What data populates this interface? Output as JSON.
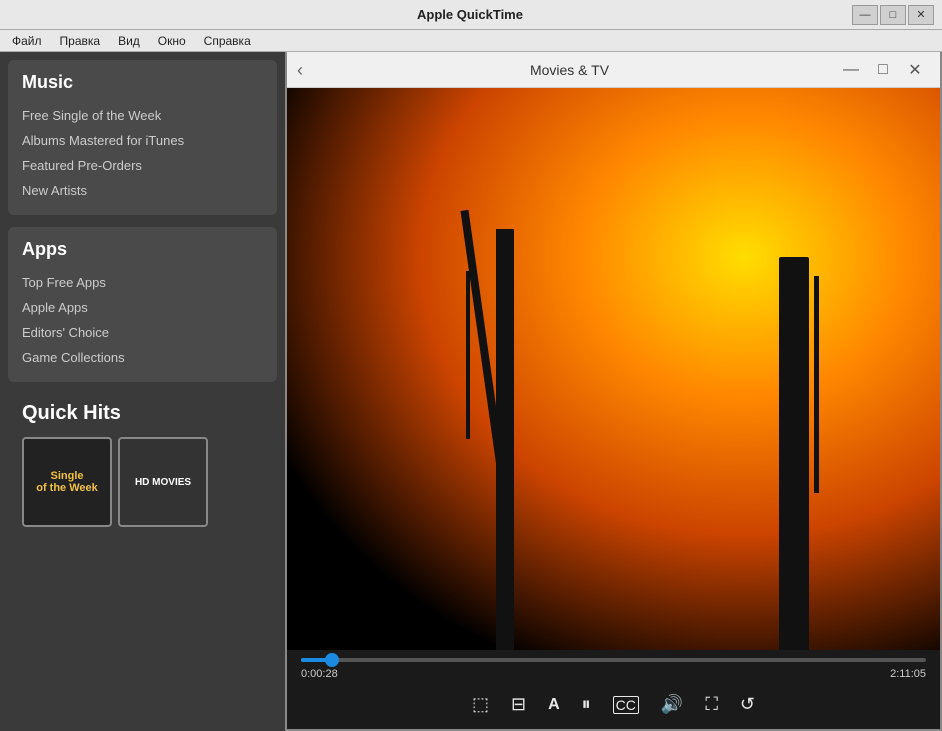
{
  "window": {
    "title": "Apple QuickTime",
    "controls": {
      "minimize": "—",
      "maximize": "□",
      "close": "✕"
    }
  },
  "menu": {
    "items": [
      "Файл",
      "Правка",
      "Вид",
      "Окно",
      "Справка"
    ]
  },
  "sidebar": {
    "music_section": {
      "title": "Music",
      "links": [
        "Free Single of the Week",
        "Albums Mastered for iTunes",
        "Featured Pre-Orders",
        "New Artists"
      ]
    },
    "apps_section": {
      "title": "Apps",
      "links": [
        "Top Free Apps",
        "Apple Apps",
        "Editors' Choice",
        "Game Collections"
      ]
    },
    "quick_hits": {
      "title": "Quick Hits",
      "thumbnail1_text": "Single\nof the Week",
      "thumbnail2_text": "HD MOVIES"
    }
  },
  "video_window": {
    "title": "Movies & TV",
    "back_btn": "‹",
    "minimize": "—",
    "maximize": "□",
    "close": "✕",
    "current_time": "0:00:28",
    "total_time": "2:11:05",
    "progress_percent": 5.2
  },
  "controls": {
    "loop": "⟳",
    "chapters": "⊟",
    "captions_font": "A",
    "pause": "⏸",
    "captions": "CC",
    "volume": "🔊",
    "fullscreen": "⛶",
    "reload": "↺"
  }
}
